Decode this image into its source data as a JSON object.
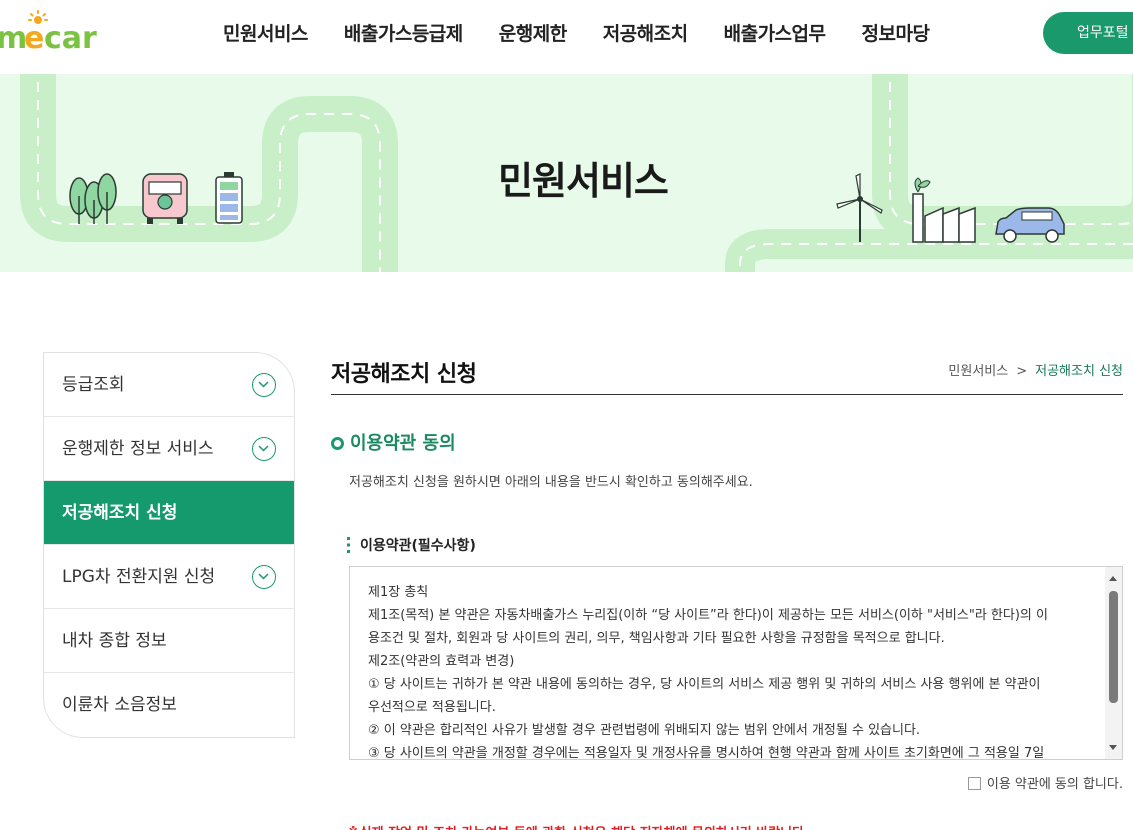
{
  "header": {
    "logo_alt": "mecar",
    "nav": [
      "민원서비스",
      "배출가스등급제",
      "운행제한",
      "저공해조치",
      "배출가스업무",
      "정보마당"
    ],
    "portal_button": "업무포털"
  },
  "banner": {
    "title": "민원서비스"
  },
  "sidebar": {
    "items": [
      {
        "label": "등급조회",
        "expandable": true,
        "active": false
      },
      {
        "label": "운행제한 정보 서비스",
        "expandable": true,
        "active": false
      },
      {
        "label": "저공해조치 신청",
        "expandable": false,
        "active": true
      },
      {
        "label": "LPG차 전환지원 신청",
        "expandable": true,
        "active": false
      },
      {
        "label": "내차 종합 정보",
        "expandable": false,
        "active": false
      },
      {
        "label": "이륜차 소음정보",
        "expandable": false,
        "active": false
      }
    ]
  },
  "content": {
    "page_title": "저공해조치 신청",
    "breadcrumb": {
      "root": "민원서비스",
      "separator": ">",
      "current": "저공해조치 신청"
    },
    "section_title": "이용약관 동의",
    "section_desc": "저공해조치 신청을 원하시면 아래의 내용을 반드시 확인하고 동의해주세요.",
    "terms_title": "이용약관(필수사항)",
    "terms_lines": [
      "제1장  총칙",
      "제1조(목적) 본 약관은 자동차배출가스 누리집(이하 “당 사이트”라 한다)이 제공하는 모든 서비스(이하 \"서비스\"라 한다)의 이",
      "용조건 및 절차, 회원과 당 사이트의 권리, 의무, 책임사항과 기타 필요한 사항을 규정함을 목적으로 합니다.",
      "제2조(약관의 효력과 변경)",
      "① 당 사이트는 귀하가 본 약관 내용에 동의하는 경우, 당 사이트의 서비스 제공 행위 및 귀하의 서비스 사용 행위에 본 약관이",
      "우선적으로 적용됩니다.",
      "② 이 약관은 합리적인 사유가 발생할 경우 관련법령에 위배되지 않는 범위 안에서 개정될 수 있습니다.",
      "③ 당 사이트의 약관을 개정할 경우에는 적용일자 및 개정사유를 명시하여 현행 약관과 함께 사이트 초기화면에 그 적용일 7일"
    ],
    "agree_label": "이용 약관에 동의 합니다.",
    "agree_checked": false,
    "notice_partial": "※실제 작업 및 조치 가능여부 등에 관한 신청은 해당 지자체에 문의하시기 바랍니다."
  },
  "colors": {
    "brand_green": "#149a6c",
    "banner_bg": "#e8fbea",
    "notice_red": "#e02020"
  }
}
